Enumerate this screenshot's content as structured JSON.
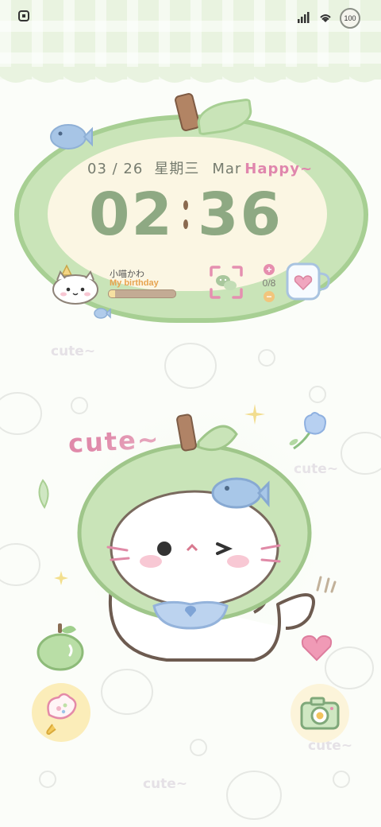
{
  "status_bar": {
    "left_icon": "app-notification-icon",
    "right_icons": [
      "signal-icon",
      "wifi-icon"
    ],
    "battery": "100"
  },
  "clock_widget": {
    "date": "03 / 26",
    "weekday": "星期三",
    "month": "Mar",
    "greeting": "Happy~",
    "time_hours": "02",
    "time_minutes": "36"
  },
  "birthday_widget": {
    "name": "小喵かわ",
    "label": "My birthday",
    "progress": 0.1
  },
  "shortcuts_widget": {
    "scan_icon": "wechat-scan-icon",
    "counter": "0/8",
    "plus": "+",
    "minus": "−",
    "mug_icon": "heart-mug-icon"
  },
  "wallpaper": {
    "cute_text": "cute~",
    "deco_texts": [
      "cute~",
      "cute~",
      "cute~",
      "cute~"
    ]
  },
  "dock": {
    "left_app_icon": "flower-icon",
    "right_app_icon": "camera-icon"
  },
  "colors": {
    "apple_green": "#c9e4b8",
    "apple_border": "#a7cf93",
    "clock_green": "#8ea983",
    "pink": "#e086ad"
  }
}
